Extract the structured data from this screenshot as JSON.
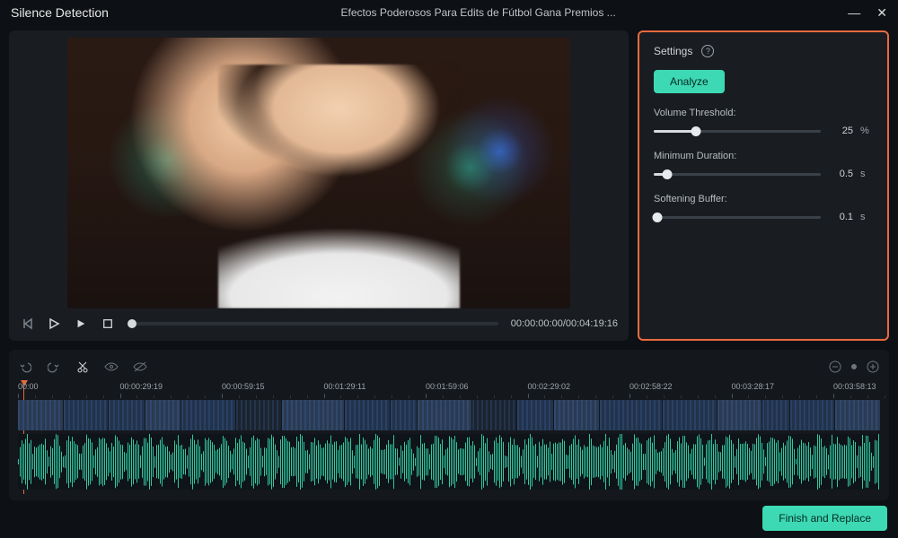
{
  "titlebar": {
    "app_name": "Silence Detection",
    "file_name": "Efectos Poderosos Para Edits de Fútbol   Gana Premios ..."
  },
  "transport": {
    "timecode": "00:00:00:00/00:04:19:16"
  },
  "settings": {
    "heading": "Settings",
    "analyze_label": "Analyze",
    "params": {
      "volume_threshold": {
        "label": "Volume Threshold:",
        "value": "25",
        "unit": "%",
        "pct": 25
      },
      "minimum_duration": {
        "label": "Minimum Duration:",
        "value": "0.5",
        "unit": "s",
        "pct": 8
      },
      "softening_buffer": {
        "label": "Softening Buffer:",
        "value": "0.1",
        "unit": "s",
        "pct": 2
      }
    }
  },
  "timeline": {
    "ruler": [
      "00:00",
      "00:00:29:19",
      "00:00:59:15",
      "00:01:29:11",
      "00:01:59:06",
      "00:02:29:02",
      "00:02:58:22",
      "00:03:28:17",
      "00:03:58:13"
    ]
  },
  "footer": {
    "finish_label": "Finish and Replace"
  }
}
